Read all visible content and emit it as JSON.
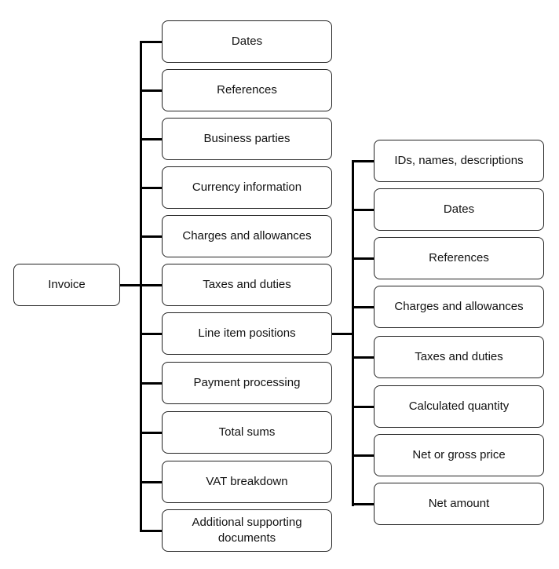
{
  "root": {
    "label": "Invoice"
  },
  "level1": [
    {
      "label": "Dates"
    },
    {
      "label": "References"
    },
    {
      "label": "Business parties"
    },
    {
      "label": "Currency information"
    },
    {
      "label": "Charges and allowances"
    },
    {
      "label": "Taxes and duties"
    },
    {
      "label": "Line item positions"
    },
    {
      "label": "Payment processing"
    },
    {
      "label": "Total sums"
    },
    {
      "label": "VAT breakdown"
    },
    {
      "label": "Additional supporting documents"
    }
  ],
  "line_item_children": [
    {
      "label": "IDs, names, descriptions"
    },
    {
      "label": "Dates"
    },
    {
      "label": "References"
    },
    {
      "label": "Charges and allowances"
    },
    {
      "label": "Taxes and duties"
    },
    {
      "label": "Calculated quantity"
    },
    {
      "label": "Net or gross price"
    },
    {
      "label": "Net amount"
    }
  ]
}
